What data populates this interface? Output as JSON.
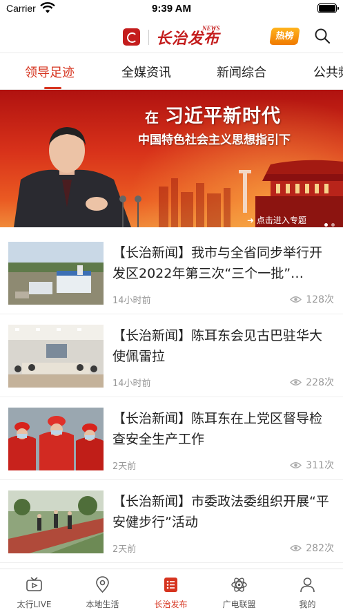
{
  "status_bar": {
    "carrier": "Carrier",
    "time": "9:39 AM"
  },
  "header": {
    "logo_text": "长治发布",
    "logo_sup": "NEWS",
    "hot_badge": "热榜"
  },
  "tabs": [
    {
      "label": "领导足迹",
      "active": true
    },
    {
      "label": "全媒资讯",
      "active": false
    },
    {
      "label": "新闻综合",
      "active": false
    },
    {
      "label": "公共频",
      "active": false
    }
  ],
  "banner": {
    "headline_prefix": "在",
    "headline": "习近平新时代",
    "subline": "中国特色社会主义思想指引下",
    "cta": "点击进入专题",
    "slides": 2,
    "current_slide": 1
  },
  "news": [
    {
      "title": "【长治新闻】我市与全省同步举行开发区2022年第三次“三个一批”…",
      "time": "14小时前",
      "views": "128次",
      "thumb": "construction-site"
    },
    {
      "title": "【长治新闻】陈耳东会见古巴驻华大使佩雷拉",
      "time": "14小时前",
      "views": "228次",
      "thumb": "meeting-room"
    },
    {
      "title": "【长治新闻】陈耳东在上党区督导检查安全生产工作",
      "time": "2天前",
      "views": "311次",
      "thumb": "safety-inspection"
    },
    {
      "title": "【长治新闻】市委政法委组织开展“平安健步行”活动",
      "time": "2天前",
      "views": "282次",
      "thumb": "walking-path"
    }
  ],
  "tabbar": [
    {
      "label": "太行LIVE",
      "icon": "tv-icon",
      "active": false
    },
    {
      "label": "本地生活",
      "icon": "location-pin-icon",
      "active": false
    },
    {
      "label": "长治发布",
      "icon": "list-icon",
      "active": true
    },
    {
      "label": "广电联盟",
      "icon": "atom-icon",
      "active": false
    },
    {
      "label": "我的",
      "icon": "person-icon",
      "active": false
    }
  ],
  "colors": {
    "accent": "#d6341f",
    "brand": "#c41d1d"
  }
}
